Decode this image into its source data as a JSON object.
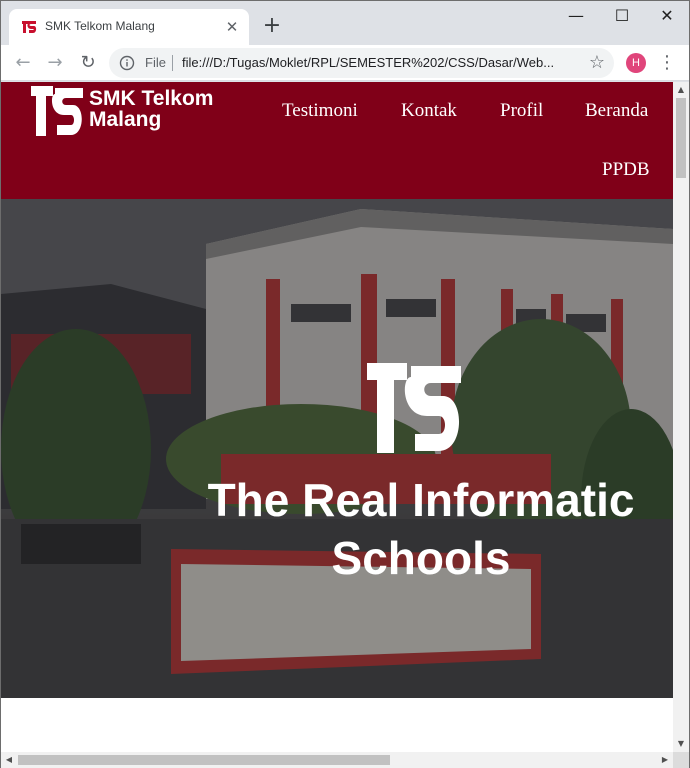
{
  "browser": {
    "tab": {
      "title": "SMK Telkom Malang",
      "favicon": "telkom-school-logo",
      "close_glyph": "✕"
    },
    "new_tab_glyph": "+",
    "window_controls": {
      "minimize": "—",
      "maximize": "☐",
      "close": "✕"
    },
    "toolbar": {
      "back_glyph": "←",
      "forward_glyph": "→",
      "reload_glyph": "↻",
      "scheme_label": "File",
      "url": "file:///D:/Tugas/Moklet/RPL/SEMESTER%202/CSS/Dasar/Web...",
      "bookmark_glyph": "☆",
      "profile_initial": "H",
      "menu_glyph": "⋮"
    },
    "colors": {
      "tabstrip": "#dee1e6",
      "profile": "#e0457b"
    }
  },
  "site": {
    "brand": {
      "line1": "SMK Telkom",
      "line2": "Malang"
    },
    "nav": {
      "testimoni": "Testimoni",
      "kontak": "Kontak",
      "profil": "Profil",
      "beranda": "Beranda",
      "ppdb": "PPDB"
    },
    "hero": {
      "title_line1": "The Real Informatic",
      "title_line2": "Schools"
    },
    "colors": {
      "header": "#800018",
      "accent": "#c8102e"
    }
  },
  "scrollbars": {
    "up": "▲",
    "down": "▼",
    "left": "◀",
    "right": "▶"
  }
}
